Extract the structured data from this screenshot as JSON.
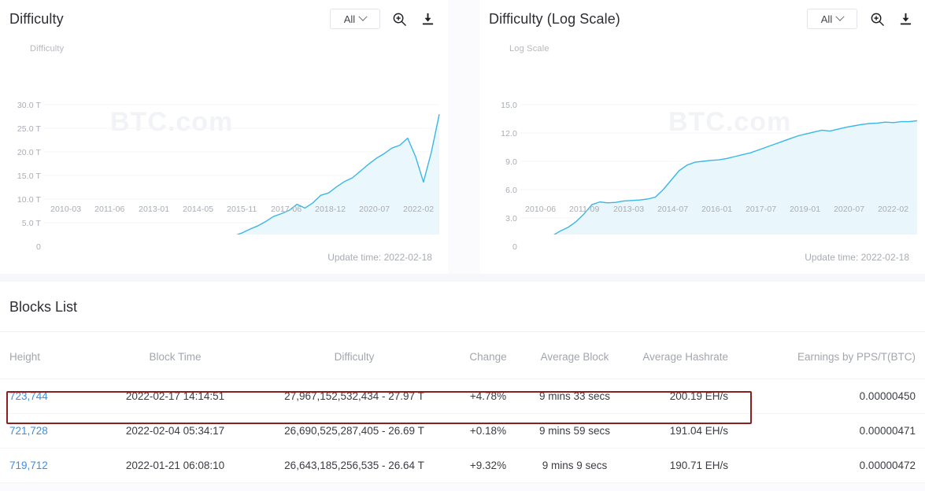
{
  "charts": [
    {
      "title": "Difficulty",
      "range_label": "All",
      "axis_name": "Difficulty",
      "update_time": "Update time: 2022-02-18",
      "watermark": "BTC.com",
      "zoom_icon": "zoom-in-icon",
      "download_icon": "download-icon",
      "chevron_icon": "chevron-down-icon"
    },
    {
      "title": "Difficulty (Log Scale)",
      "range_label": "All",
      "axis_name": "Log Scale",
      "update_time": "Update time: 2022-02-18",
      "watermark": "BTC.com",
      "zoom_icon": "zoom-in-icon",
      "download_icon": "download-icon",
      "chevron_icon": "chevron-down-icon"
    }
  ],
  "chart_data": [
    {
      "type": "area",
      "title": "Difficulty",
      "xlabel": "",
      "ylabel": "Difficulty",
      "ylim": [
        0,
        30
      ],
      "ytick_labels": [
        "0",
        "5.0 T",
        "10.0 T",
        "15.0 T",
        "20.0 T",
        "25.0 T",
        "30.0 T"
      ],
      "ytick_values": [
        0,
        5,
        10,
        15,
        20,
        25,
        30
      ],
      "xtick_labels": [
        "2010-03",
        "2011-06",
        "2013-01",
        "2014-05",
        "2015-11",
        "2017-06",
        "2018-12",
        "2020-07",
        "2022-02"
      ],
      "grid": true,
      "legend": "none",
      "line_color": "#3ab7e8",
      "fill_color": "#eaf7fc",
      "x": [
        0,
        2,
        4,
        6,
        8,
        10,
        12,
        14,
        16,
        18,
        20,
        22,
        24,
        26,
        28,
        30,
        32,
        34,
        36,
        38,
        40,
        42,
        44,
        46,
        48,
        50,
        52,
        54,
        56,
        58,
        60,
        62,
        64,
        66,
        68,
        70,
        72,
        74,
        76,
        78,
        80,
        82,
        84,
        86,
        88,
        90,
        92,
        94,
        96,
        98,
        100
      ],
      "values": [
        0,
        0,
        0,
        0,
        0,
        0,
        0,
        0.01,
        0.02,
        0.03,
        0.05,
        0.08,
        0.1,
        0.15,
        0.2,
        0.3,
        0.45,
        0.7,
        1.2,
        1.8,
        2.1,
        1.6,
        1.5,
        1.7,
        2.2,
        2.8,
        3.6,
        4.3,
        5.2,
        6.3,
        6.9,
        7.6,
        8.9,
        8.1,
        9.2,
        10.8,
        11.3,
        12.6,
        13.7,
        14.5,
        15.9,
        17.3,
        18.6,
        19.6,
        20.8,
        21.4,
        22.9,
        19.0,
        13.6,
        20.0,
        27.97
      ]
    },
    {
      "type": "area",
      "title": "Difficulty (Log Scale)",
      "xlabel": "",
      "ylabel": "Log Scale",
      "ylim": [
        0,
        15
      ],
      "ytick_labels": [
        "0",
        "3.0",
        "6.0",
        "9.0",
        "12.0",
        "15.0"
      ],
      "ytick_values": [
        0,
        3,
        6,
        9,
        12,
        15
      ],
      "xtick_labels": [
        "2010-06",
        "2011-09",
        "2013-03",
        "2014-07",
        "2016-01",
        "2017-07",
        "2019-01",
        "2020-07",
        "2022-02"
      ],
      "grid": true,
      "legend": "none",
      "line_color": "#3ab7e8",
      "fill_color": "#e9f6fb",
      "x": [
        0,
        2,
        4,
        6,
        8,
        10,
        12,
        14,
        16,
        18,
        20,
        22,
        24,
        26,
        28,
        30,
        32,
        34,
        36,
        38,
        40,
        42,
        44,
        46,
        48,
        50,
        52,
        54,
        56,
        58,
        60,
        62,
        64,
        66,
        68,
        70,
        72,
        74,
        76,
        78,
        80,
        82,
        84,
        86,
        88,
        90,
        92,
        94,
        96,
        98,
        100
      ],
      "values": [
        0,
        0,
        0.05,
        0.4,
        1.1,
        1.6,
        2.0,
        2.6,
        3.4,
        4.4,
        4.7,
        4.6,
        4.65,
        4.8,
        4.85,
        4.9,
        5.0,
        5.2,
        6.0,
        7.0,
        8.0,
        8.6,
        8.9,
        9.0,
        9.1,
        9.15,
        9.3,
        9.5,
        9.7,
        9.9,
        10.2,
        10.5,
        10.8,
        11.1,
        11.4,
        11.7,
        11.9,
        12.1,
        12.3,
        12.2,
        12.4,
        12.6,
        12.75,
        12.9,
        13.0,
        13.05,
        13.15,
        13.1,
        13.2,
        13.2,
        13.3
      ]
    }
  ],
  "blocks": {
    "section_title": "Blocks List",
    "columns": [
      "Height",
      "Block Time",
      "Difficulty",
      "Change",
      "Average Block",
      "Average Hashrate",
      "Earnings by PPS/T(BTC)"
    ],
    "rows": [
      {
        "height": "723,744",
        "block_time": "2022-02-17 14:14:51",
        "difficulty": "27,967,152,532,434 - 27.97 T",
        "change": "+4.78%",
        "average_block": "9 mins 33 secs",
        "average_hashrate": "200.19 EH/s",
        "earnings": "0.00000450",
        "highlighted": true
      },
      {
        "height": "721,728",
        "block_time": "2022-02-04 05:34:17",
        "difficulty": "26,690,525,287,405 - 26.69 T",
        "change": "+0.18%",
        "average_block": "9 mins 59 secs",
        "average_hashrate": "191.04 EH/s",
        "earnings": "0.00000471",
        "highlighted": false
      },
      {
        "height": "719,712",
        "block_time": "2022-01-21 06:08:10",
        "difficulty": "26,643,185,256,535 - 26.64 T",
        "change": "+9.32%",
        "average_block": "9 mins 9 secs",
        "average_hashrate": "190.71 EH/s",
        "earnings": "0.00000472",
        "highlighted": false
      }
    ]
  },
  "colors": {
    "accent_line": "#3ab7e8",
    "link": "#3a8ee6",
    "positive": "#2fa37a",
    "highlight_border": "#8d1f1f"
  }
}
